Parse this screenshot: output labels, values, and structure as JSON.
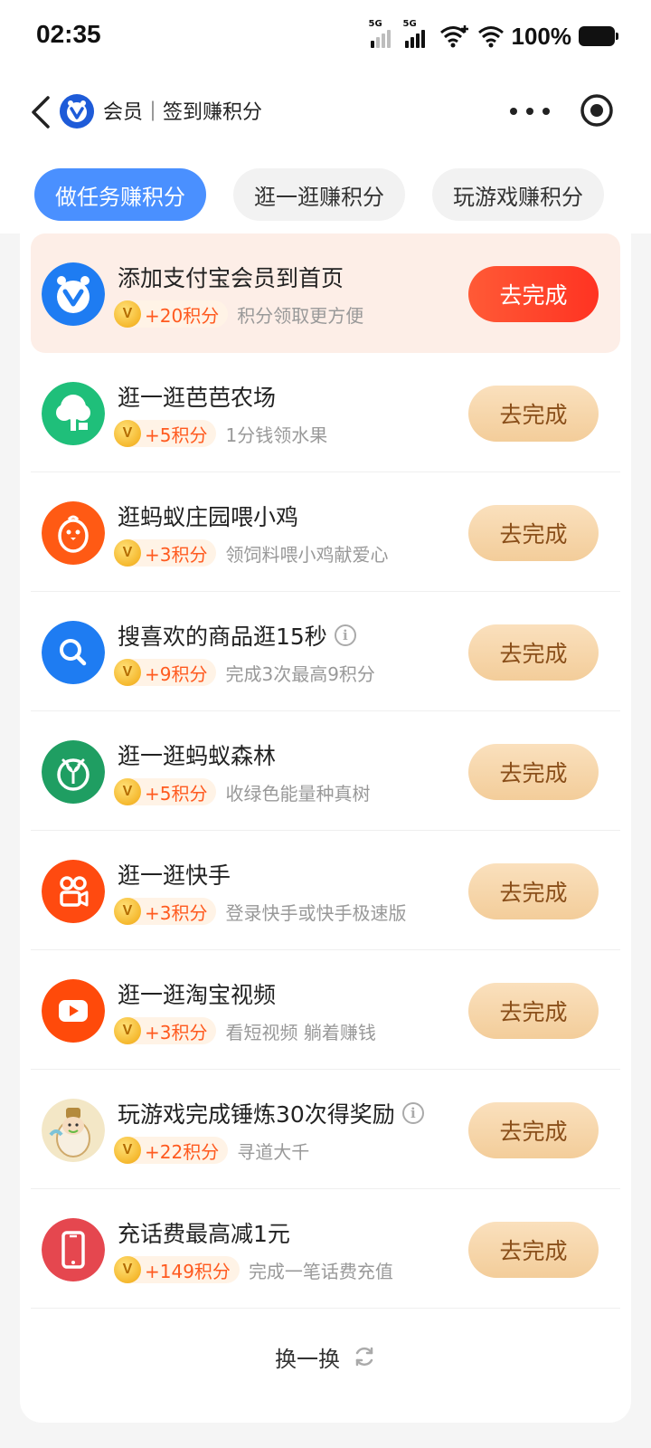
{
  "status_bar": {
    "time": "02:35",
    "signal1_label": "5G",
    "signal2_label": "5G",
    "battery": "100%"
  },
  "nav": {
    "title": "会员｜签到赚积分",
    "back_icon": "chevron-left-icon",
    "more_icon": "more-dots-icon",
    "close_icon": "target-close-icon"
  },
  "tabs": [
    {
      "label": "做任务赚积分",
      "active": true
    },
    {
      "label": "逛一逛赚积分",
      "active": false
    },
    {
      "label": "玩游戏赚积分",
      "active": false
    }
  ],
  "tasks": [
    {
      "title": "添加支付宝会员到首页",
      "points": "+20积分",
      "desc": "积分领取更方便",
      "button": "去完成",
      "icon": "alipay-member-icon",
      "color": "#1e7cf2",
      "highlight": true,
      "info": false
    },
    {
      "title": "逛一逛芭芭农场",
      "points": "+5积分",
      "desc": "1分钱领水果",
      "button": "去完成",
      "icon": "farm-tree-icon",
      "color": "#1fbf7a",
      "highlight": false,
      "info": false
    },
    {
      "title": "逛蚂蚁庄园喂小鸡",
      "points": "+3积分",
      "desc": "领饲料喂小鸡献爱心",
      "button": "去完成",
      "icon": "chick-icon",
      "color": "#ff5a14",
      "highlight": false,
      "info": false
    },
    {
      "title": "搜喜欢的商品逛15秒",
      "points": "+9积分",
      "desc": "完成3次最高9积分",
      "button": "去完成",
      "icon": "search-icon",
      "color": "#1e7cf2",
      "highlight": false,
      "info": true
    },
    {
      "title": "逛一逛蚂蚁森林",
      "points": "+5积分",
      "desc": "收绿色能量种真树",
      "button": "去完成",
      "icon": "sprout-icon",
      "color": "#1f9e62",
      "highlight": false,
      "info": false
    },
    {
      "title": "逛一逛快手",
      "points": "+3积分",
      "desc": "登录快手或快手极速版",
      "button": "去完成",
      "icon": "kuaishou-icon",
      "color": "#ff4a10",
      "highlight": false,
      "info": false
    },
    {
      "title": "逛一逛淘宝视频",
      "points": "+3积分",
      "desc": "看短视频 躺着赚钱",
      "button": "去完成",
      "icon": "video-play-icon",
      "color": "#ff4a0a",
      "highlight": false,
      "info": false
    },
    {
      "title": "玩游戏完成锤炼30次得奖励",
      "points": "+22积分",
      "desc": "寻道大千",
      "button": "去完成",
      "icon": "game-character-icon",
      "color": "#f3e7c6",
      "highlight": false,
      "info": true
    },
    {
      "title": "充话费最高减1元",
      "points": "+149积分",
      "desc": "完成一笔话费充值",
      "button": "去完成",
      "icon": "phone-icon",
      "color": "#e5474f",
      "highlight": false,
      "info": false
    }
  ],
  "refresh": {
    "label": "换一换",
    "icon": "refresh-icon"
  },
  "coin_symbol": "V"
}
